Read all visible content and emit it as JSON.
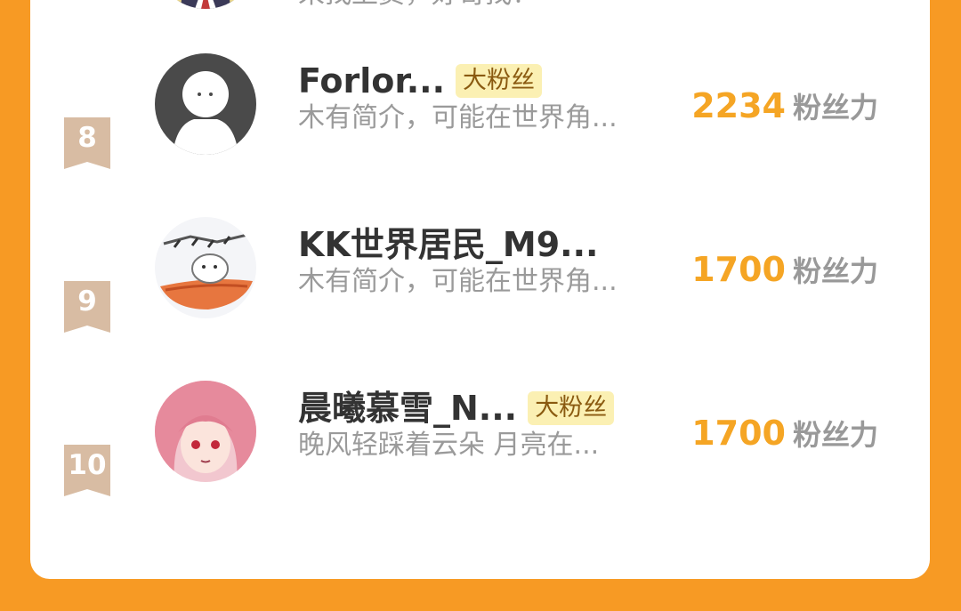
{
  "top_partial": {
    "bio": "来找上资，好哥找！"
  },
  "rows": [
    {
      "rank": "8",
      "name": "Forlor...",
      "badge": "大粉丝",
      "bio": "木有简介，可能在世界角...",
      "fans_value": "2234",
      "fans_label": "粉丝力"
    },
    {
      "rank": "9",
      "name": "KK世界居民_M9...",
      "badge": "",
      "bio": "木有简介，可能在世界角...",
      "fans_value": "1700",
      "fans_label": "粉丝力"
    },
    {
      "rank": "10",
      "name": "晨曦慕雪_N...",
      "badge": "大粉丝",
      "bio": "晚风轻踩着云朵 月亮在...",
      "fans_value": "1700",
      "fans_label": "粉丝力"
    }
  ],
  "colors": {
    "background": "#f79a24",
    "fans_value": "#f5a524",
    "rank_ribbon": "#d8bca3",
    "badge_bg": "#fbf0b3"
  }
}
